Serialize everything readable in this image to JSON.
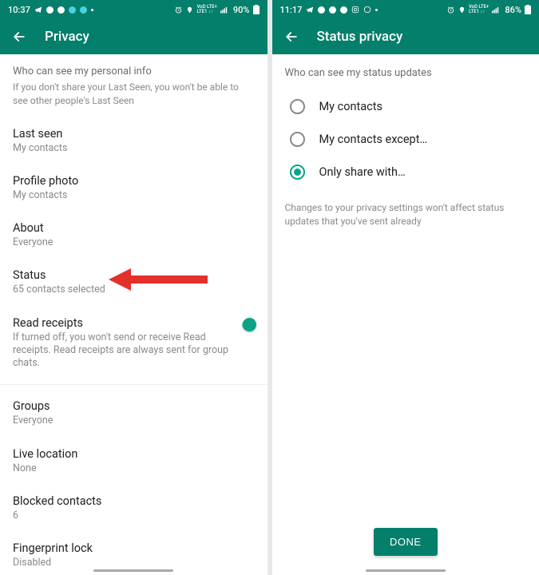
{
  "left": {
    "status": {
      "time": "10:37",
      "battery": "90%",
      "network": "LTE1"
    },
    "app_title": "Privacy",
    "personal_info_header": "Who can see my personal info",
    "personal_info_hint": "If you don't share your Last Seen, you won't be able to see other people's Last Seen",
    "items": {
      "last_seen": {
        "title": "Last seen",
        "sub": "My contacts"
      },
      "profile_photo": {
        "title": "Profile photo",
        "sub": "My contacts"
      },
      "about": {
        "title": "About",
        "sub": "Everyone"
      },
      "status": {
        "title": "Status",
        "sub": "65 contacts selected"
      },
      "read_receipts": {
        "title": "Read receipts",
        "sub": "If turned off, you won't send or receive Read receipts. Read receipts are always sent for group chats."
      },
      "groups": {
        "title": "Groups",
        "sub": "Everyone"
      },
      "live_location": {
        "title": "Live location",
        "sub": "None"
      },
      "blocked": {
        "title": "Blocked contacts",
        "sub": "6"
      },
      "fingerprint": {
        "title": "Fingerprint lock",
        "sub": "Disabled"
      }
    }
  },
  "right": {
    "status": {
      "time": "11:17",
      "battery": "86%",
      "network": "LTE1"
    },
    "app_title": "Status privacy",
    "header": "Who can see my status updates",
    "options": {
      "my_contacts": "My contacts",
      "except": "My contacts except…",
      "only_share": "Only share with…"
    },
    "footer_hint": "Changes to your privacy settings won't affect status updates that you've sent already",
    "done_label": "DONE"
  }
}
